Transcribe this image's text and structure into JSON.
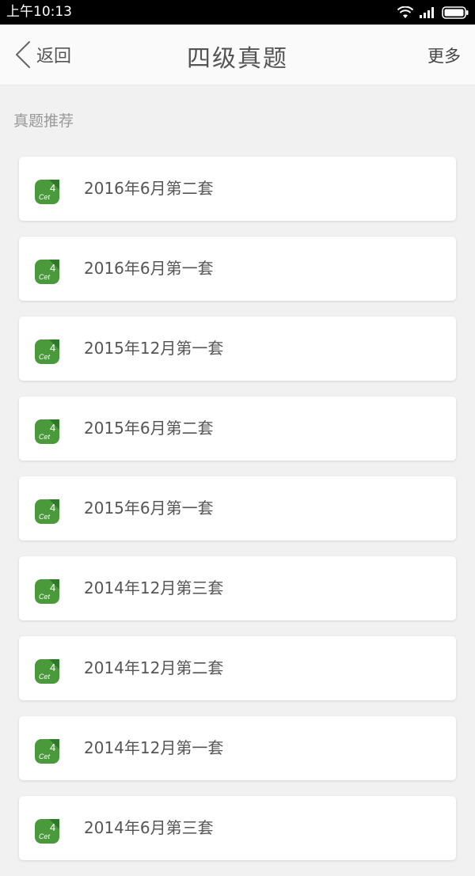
{
  "status_bar": {
    "time": "上午10:13",
    "icons": [
      "wifi-icon",
      "signal-icon",
      "battery-icon"
    ]
  },
  "header": {
    "back_label": "返回",
    "title": "四级真题",
    "more_label": "更多"
  },
  "section": {
    "title": "真题推荐"
  },
  "items": [
    {
      "label": "2016年6月第二套"
    },
    {
      "label": "2016年6月第一套"
    },
    {
      "label": "2015年12月第一套"
    },
    {
      "label": "2015年6月第二套"
    },
    {
      "label": "2015年6月第一套"
    },
    {
      "label": "2014年12月第三套"
    },
    {
      "label": "2014年12月第二套"
    },
    {
      "label": "2014年12月第一套"
    },
    {
      "label": "2014年6月第三套"
    }
  ],
  "icon": {
    "number": "4",
    "text": "Cet"
  },
  "colors": {
    "icon_green": "#4a9a3c",
    "icon_green_dark": "#2f7a28",
    "background": "#f1f1f1"
  }
}
